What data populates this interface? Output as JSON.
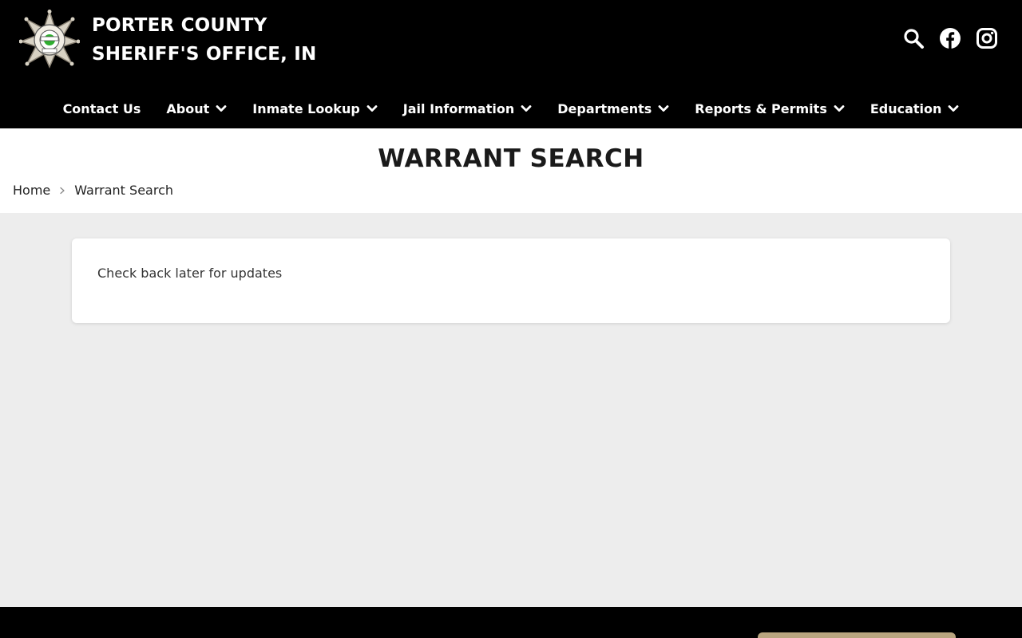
{
  "header": {
    "title_line1": "PORTER COUNTY",
    "title_line2": "SHERIFF'S OFFICE, IN",
    "logo_icon": "sheriff-star-badge",
    "social": [
      {
        "name": "search-icon"
      },
      {
        "name": "facebook-icon"
      },
      {
        "name": "instagram-icon"
      }
    ]
  },
  "nav": {
    "items": [
      {
        "label": "Contact Us",
        "has_dropdown": false
      },
      {
        "label": "About",
        "has_dropdown": true
      },
      {
        "label": "Inmate Lookup",
        "has_dropdown": true
      },
      {
        "label": "Jail Information",
        "has_dropdown": true
      },
      {
        "label": "Departments",
        "has_dropdown": true
      },
      {
        "label": "Reports & Permits",
        "has_dropdown": true
      },
      {
        "label": "Education",
        "has_dropdown": true
      }
    ]
  },
  "page": {
    "title": "WARRANT SEARCH",
    "breadcrumb": {
      "home": "Home",
      "current": "Warrant Search"
    },
    "message": "Check back later for updates"
  },
  "colors": {
    "header_bg": "#000000",
    "content_bg": "#ededed",
    "accent_tan": "#b9a57f",
    "badge_green": "#2fae2f"
  }
}
